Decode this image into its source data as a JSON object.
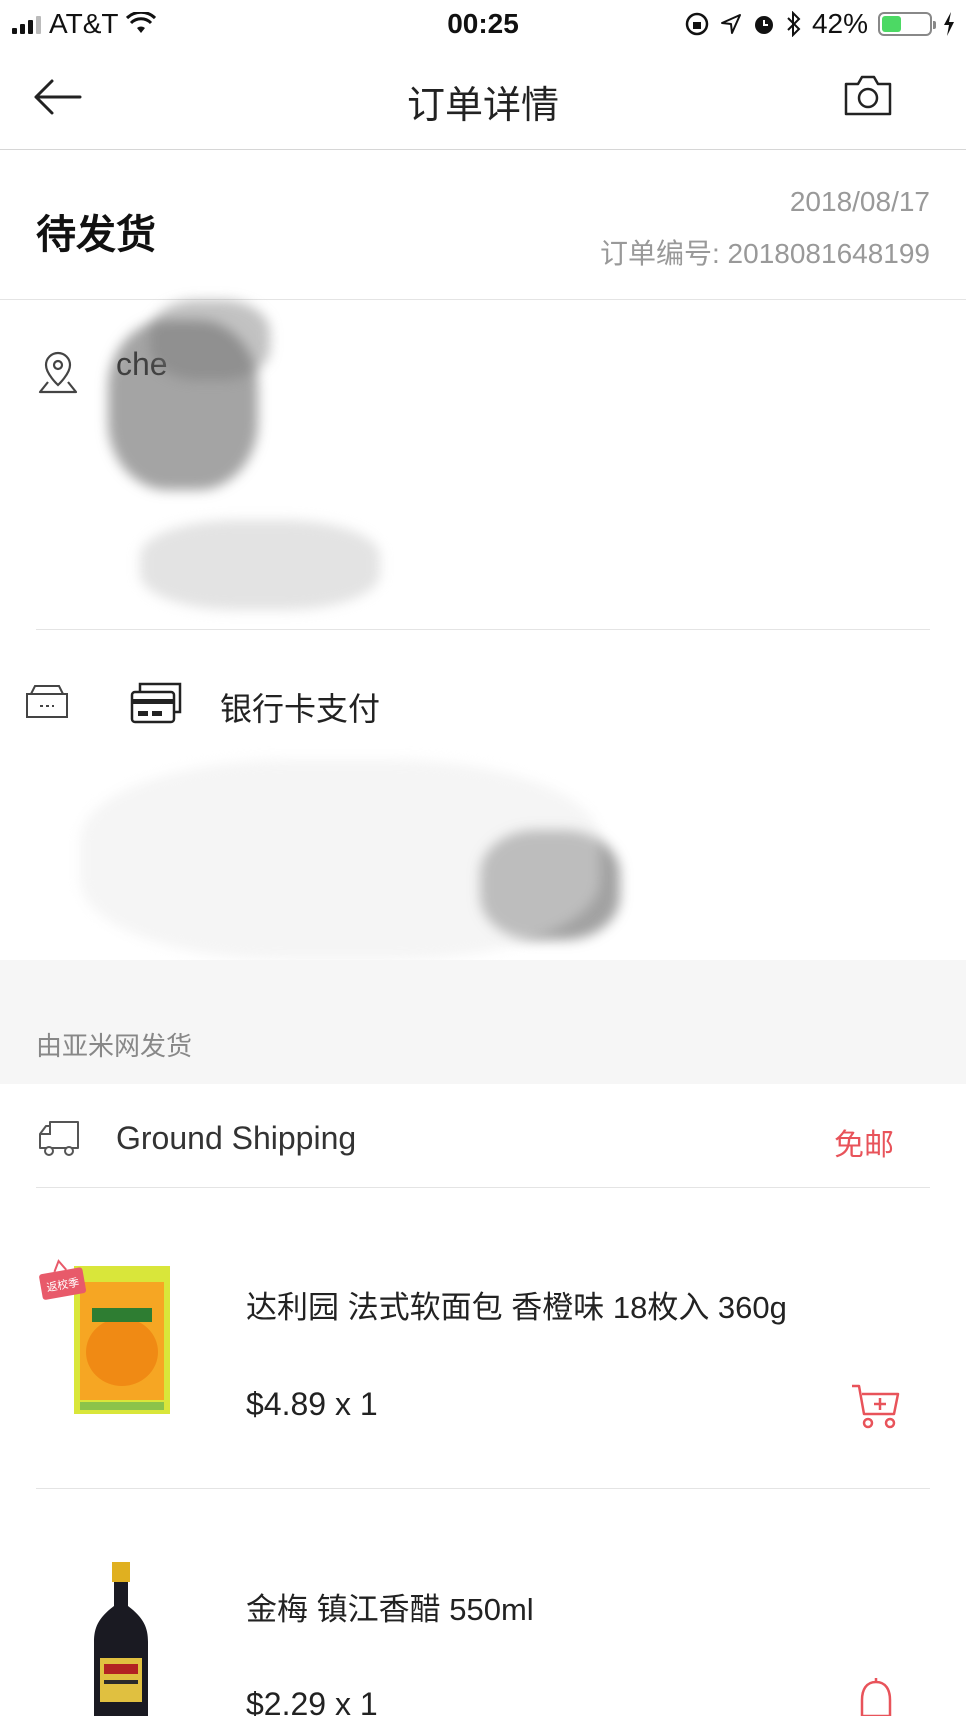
{
  "status_bar": {
    "carrier": "AT&T",
    "time": "00:25",
    "battery_percent": "42%",
    "battery_level": 0.42
  },
  "nav": {
    "title": "订单详情",
    "back_icon": "arrow-left-icon",
    "camera_icon": "camera-icon"
  },
  "order": {
    "status": "待发货",
    "date": "2018/08/17",
    "number_label": "订单编号: 2018081648199"
  },
  "address": {
    "name_visible": "che"
  },
  "payment": {
    "method": "银行卡支付"
  },
  "shipping": {
    "source": "由亚米网发货",
    "method": "Ground Shipping",
    "fee": "免邮"
  },
  "products": [
    {
      "name": "达利园  法式软面包 香橙味 18枚入  360g",
      "price": "$4.89 x 1",
      "badge": "返校季"
    },
    {
      "name": "金梅 镇江香醋 550ml",
      "price": "$2.29 x 1"
    }
  ],
  "colors": {
    "accent": "#e8535a",
    "battery_fill": "#4cd964",
    "muted_text": "#999999",
    "section_bg": "#f6f6f6"
  }
}
